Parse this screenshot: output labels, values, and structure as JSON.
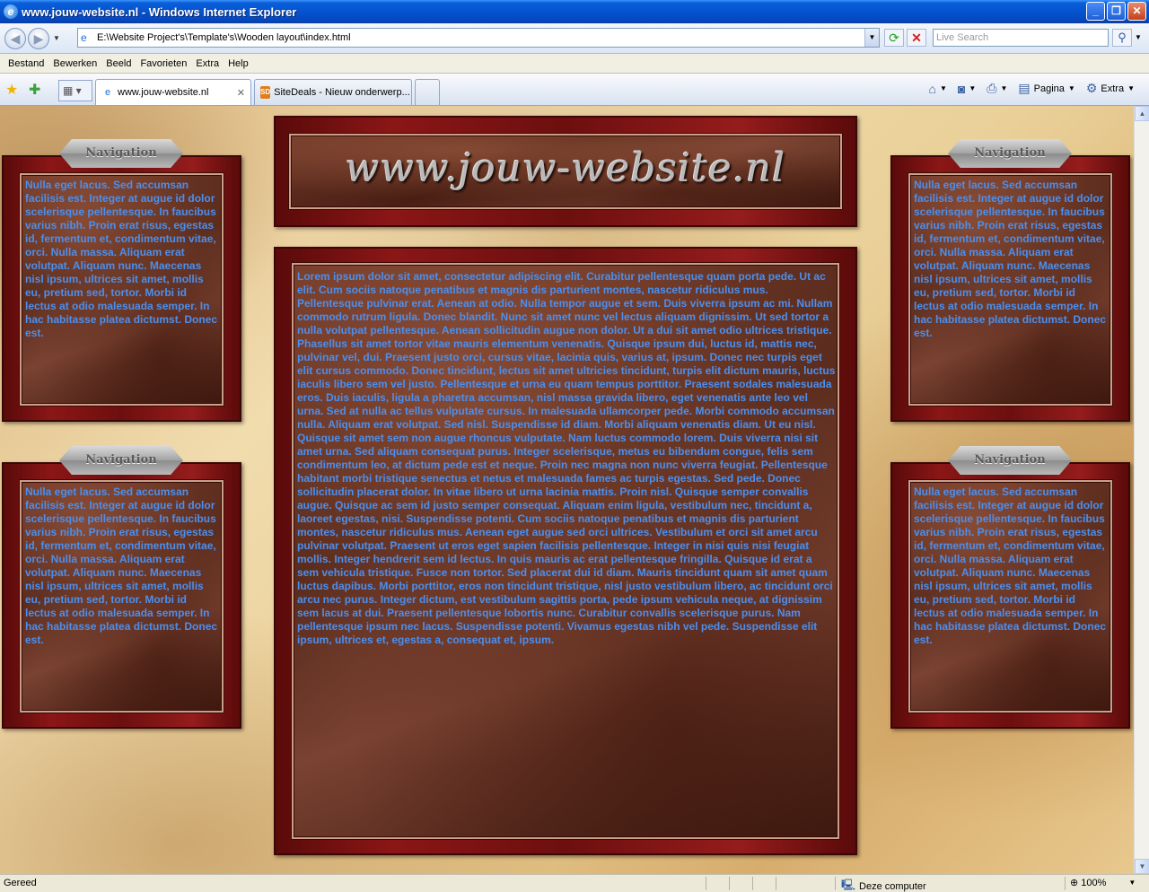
{
  "window": {
    "title": "www.jouw-website.nl - Windows Internet Explorer",
    "min_glyph": "_",
    "max_glyph": "❐",
    "close_glyph": "✕"
  },
  "address": {
    "url": "E:\\Website Project's\\Template's\\Wooden layout\\index.html",
    "search_placeholder": "Live Search"
  },
  "menu": [
    "Bestand",
    "Bewerken",
    "Beeld",
    "Favorieten",
    "Extra",
    "Help"
  ],
  "tabs": [
    {
      "label": "www.jouw-website.nl",
      "active": true
    },
    {
      "label": "SiteDeals - Nieuw onderwerp...",
      "active": false
    }
  ],
  "command_bar": {
    "page_label": "Pagina",
    "tools_label": "Extra"
  },
  "page": {
    "site_title": "www.jouw-website.nl",
    "nav_label": "Navigation",
    "side_text": "Nulla eget lacus. Sed accumsan facilisis est. Integer at augue id dolor scelerisque pellentesque. In faucibus varius nibh. Proin erat risus, egestas id, fermentum et, condimentum vitae, orci. Nulla massa. Aliquam erat volutpat. Aliquam nunc. Maecenas nisl ipsum, ultrices sit amet, mollis eu, pretium sed, tortor. Morbi id lectus at odio malesuada semper. In hac habitasse platea dictumst. Donec est.",
    "main_text": "Lorem ipsum dolor sit amet, consectetur adipiscing elit. Curabitur pellentesque quam porta pede. Ut ac elit. Cum sociis natoque penatibus et magnis dis parturient montes, nascetur ridiculus mus. Pellentesque pulvinar erat. Aenean at odio. Nulla tempor augue et sem. Duis viverra ipsum ac mi. Nullam commodo rutrum ligula. Donec blandit. Nunc sit amet nunc vel lectus aliquam dignissim. Ut sed tortor a nulla volutpat pellentesque. Aenean sollicitudin augue non dolor. Ut a dui sit amet odio ultrices tristique. Phasellus sit amet tortor vitae mauris elementum venenatis. Quisque ipsum dui, luctus id, mattis nec, pulvinar vel, dui. Praesent justo orci, cursus vitae, lacinia quis, varius at, ipsum. Donec nec turpis eget elit cursus commodo. Donec tincidunt, lectus sit amet ultricies tincidunt, turpis elit dictum mauris, luctus iaculis libero sem vel justo. Pellentesque et urna eu quam tempus porttitor. Praesent sodales malesuada eros. Duis iaculis, ligula a pharetra accumsan, nisl massa gravida libero, eget venenatis ante leo vel urna. Sed at nulla ac tellus vulputate cursus. In malesuada ullamcorper pede. Morbi commodo accumsan nulla. Aliquam erat volutpat. Sed nisl. Suspendisse id diam. Morbi aliquam venenatis diam. Ut eu nisl. Quisque sit amet sem non augue rhoncus vulputate. Nam luctus commodo lorem. Duis viverra nisi sit amet urna. Sed aliquam consequat purus. Integer scelerisque, metus eu bibendum congue, felis sem condimentum leo, at dictum pede est et neque. Proin nec magna non nunc viverra feugiat. Pellentesque habitant morbi tristique senectus et netus et malesuada fames ac turpis egestas. Sed pede. Donec sollicitudin placerat dolor. In vitae libero ut urna lacinia mattis. Proin nisl. Quisque semper convallis augue. Quisque ac sem id justo semper consequat. Aliquam enim ligula, vestibulum nec, tincidunt a, laoreet egestas, nisi. Suspendisse potenti. Cum sociis natoque penatibus et magnis dis parturient montes, nascetur ridiculus mus. Aenean eget augue sed orci ultrices. Vestibulum et orci sit amet arcu pulvinar volutpat. Praesent ut eros eget sapien facilisis pellentesque. Integer in nisi quis nisi feugiat mollis. Integer hendrerit sem id lectus. In quis mauris ac erat pellentesque fringilla. Quisque id erat a sem vehicula tristique. Fusce non tortor. Sed placerat dui id diam. Mauris tincidunt quam sit amet quam luctus dapibus. Morbi porttitor, eros non tincidunt tristique, nisl justo vestibulum libero, ac tincidunt orci arcu nec purus. Integer dictum, est vestibulum sagittis porta, pede ipsum vehicula neque, at dignissim sem lacus at dui. Praesent pellentesque lobortis nunc. Curabitur convallis scelerisque purus. Nam pellentesque ipsum nec lacus. Suspendisse potenti. Vivamus egestas nibh vel pede. Suspendisse elit ipsum, ultrices et, egestas a, consequat et, ipsum."
  },
  "status": {
    "text": "Gereed",
    "zone": "Deze computer",
    "zoom": "100%"
  }
}
